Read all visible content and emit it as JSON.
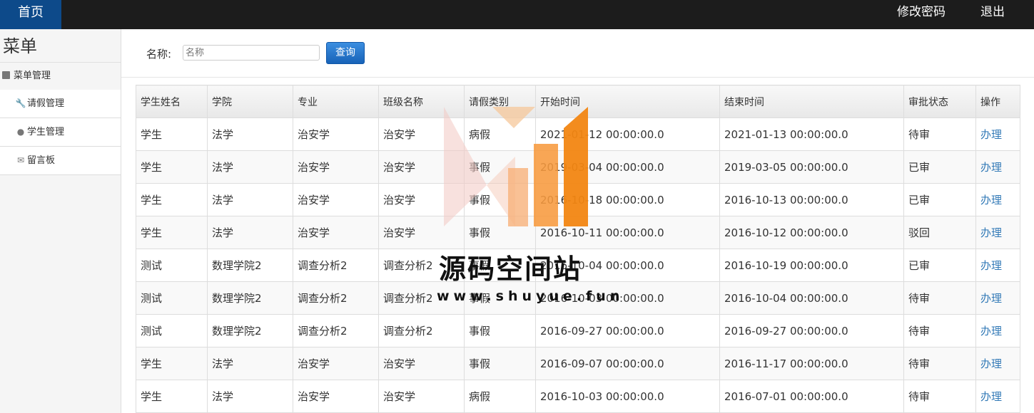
{
  "topbar": {
    "home": "首页",
    "change_password": "修改密码",
    "logout": "退出"
  },
  "sidebar": {
    "title": "菜单",
    "group": "菜单管理",
    "items": [
      {
        "label": "请假管理",
        "icon": "wrench-icon"
      },
      {
        "label": "学生管理",
        "icon": "comment-icon"
      },
      {
        "label": "留言板",
        "icon": "envelope-icon"
      }
    ]
  },
  "search": {
    "label": "名称:",
    "placeholder": "名称",
    "button": "查询"
  },
  "table": {
    "headers": [
      "学生姓名",
      "学院",
      "专业",
      "班级名称",
      "请假类别",
      "开始时间",
      "结束时间",
      "审批状态",
      "操作"
    ],
    "rows": [
      [
        "学生",
        "法学",
        "治安学",
        "治安学",
        "病假",
        "2021-01-12 00:00:00.0",
        "2021-01-13 00:00:00.0",
        "待审",
        "办理"
      ],
      [
        "学生",
        "法学",
        "治安学",
        "治安学",
        "事假",
        "2019-03-04 00:00:00.0",
        "2019-03-05 00:00:00.0",
        "已审",
        "办理"
      ],
      [
        "学生",
        "法学",
        "治安学",
        "治安学",
        "事假",
        "2016-10-18 00:00:00.0",
        "2016-10-13 00:00:00.0",
        "已审",
        "办理"
      ],
      [
        "学生",
        "法学",
        "治安学",
        "治安学",
        "事假",
        "2016-10-11 00:00:00.0",
        "2016-10-12 00:00:00.0",
        "驳回",
        "办理"
      ],
      [
        "测试",
        "数理学院2",
        "调查分析2",
        "调查分析2",
        "事假",
        "2016-10-04 00:00:00.0",
        "2016-10-19 00:00:00.0",
        "已审",
        "办理"
      ],
      [
        "测试",
        "数理学院2",
        "调查分析2",
        "调查分析2",
        "事假",
        "2016-10-03 00:00:00.0",
        "2016-10-04 00:00:00.0",
        "待审",
        "办理"
      ],
      [
        "测试",
        "数理学院2",
        "调查分析2",
        "调查分析2",
        "事假",
        "2016-09-27 00:00:00.0",
        "2016-09-27 00:00:00.0",
        "待审",
        "办理"
      ],
      [
        "学生",
        "法学",
        "治安学",
        "治安学",
        "事假",
        "2016-09-07 00:00:00.0",
        "2016-11-17 00:00:00.0",
        "待审",
        "办理"
      ],
      [
        "学生",
        "法学",
        "治安学",
        "治安学",
        "病假",
        "2016-10-03 00:00:00.0",
        "2016-07-01 00:00:00.0",
        "待审",
        "办理"
      ]
    ]
  },
  "watermark": {
    "text": "源码空间站",
    "url": "www.shuyue.fun"
  }
}
